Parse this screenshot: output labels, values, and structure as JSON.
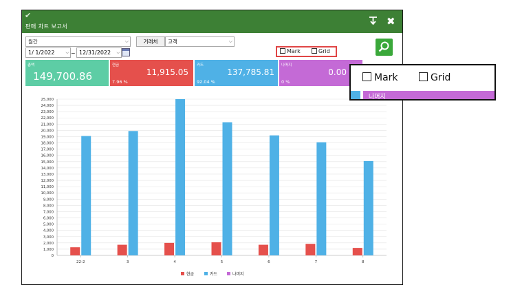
{
  "window": {
    "title": "판매 차트 보고서",
    "pin_icon": "pin-icon",
    "close_icon": "close-icon"
  },
  "filters": {
    "period_select": "월간",
    "partner_button": "거래처",
    "partner_select": "고객",
    "date_from": "1/  1/2022",
    "date_sep": "~",
    "date_to": "12/31/2022",
    "mark_label": "Mark",
    "grid_label": "Grid",
    "mark_checked": false,
    "grid_checked": false
  },
  "tiles": [
    {
      "label": "총액",
      "value": "149,700.86",
      "percent": "",
      "color": "#5dcda5"
    },
    {
      "label": "현금",
      "value": "11,915.05",
      "percent": "7.96 %",
      "color": "#e5504c"
    },
    {
      "label": "카드",
      "value": "137,785.81",
      "percent": "92.04 %",
      "color": "#4fb1e6"
    },
    {
      "label": "나머지",
      "value": "0.00",
      "percent": "0 %",
      "color": "#c46ad6"
    }
  ],
  "chart_data": {
    "type": "bar",
    "categories": [
      "22-2",
      "3",
      "4",
      "5",
      "6",
      "7",
      "8"
    ],
    "series": [
      {
        "name": "현금",
        "color": "#e5504c",
        "values": [
          1300,
          1700,
          2000,
          2100,
          1700,
          1850,
          1200
        ]
      },
      {
        "name": "카드",
        "color": "#4fb1e6",
        "values": [
          19100,
          19900,
          25000,
          21300,
          19200,
          18100,
          15100
        ]
      },
      {
        "name": "나머지",
        "color": "#c46ad6",
        "values": [
          0,
          0,
          0,
          0,
          0,
          0,
          0
        ]
      }
    ],
    "ylim": [
      0,
      25000
    ],
    "ytick_step": 1000,
    "yticks": [
      "0",
      "1,000",
      "2,000",
      "3,000",
      "4,000",
      "5,000",
      "6,000",
      "7,000",
      "8,000",
      "9,000",
      "10,000",
      "11,000",
      "12,000",
      "13,000",
      "14,000",
      "15,000",
      "16,000",
      "17,000",
      "18,000",
      "19,000",
      "20,000",
      "21,000",
      "22,000",
      "23,000",
      "24,000",
      "25,000"
    ],
    "grid": true,
    "legend_position": "bottom"
  },
  "zoom_callout": {
    "mark_label": "Mark",
    "grid_label": "Grid",
    "partial_tile_label": "나머지"
  }
}
